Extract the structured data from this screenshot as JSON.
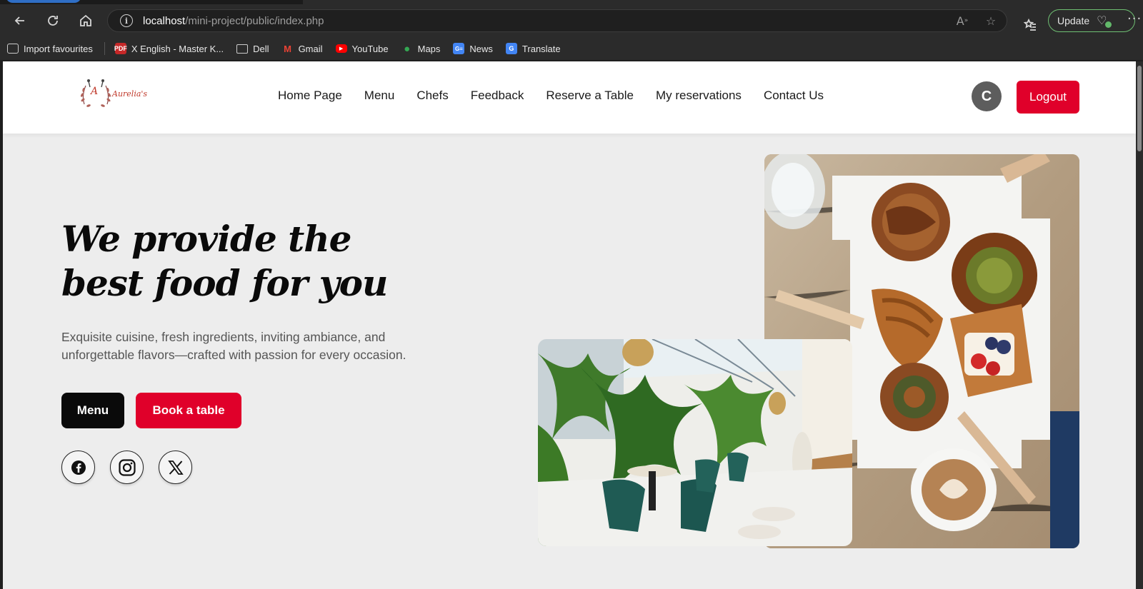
{
  "browser": {
    "url_host": "localhost",
    "url_path": "/mini-project/public/index.php",
    "update_label": "Update",
    "bookmarks": [
      {
        "label": "Import favourites",
        "icon": "import-icon"
      },
      {
        "label": "X English - Master K...",
        "icon": "pdf-icon"
      },
      {
        "label": "Dell",
        "icon": "folder-icon"
      },
      {
        "label": "Gmail",
        "icon": "gmail-icon"
      },
      {
        "label": "YouTube",
        "icon": "youtube-icon"
      },
      {
        "label": "Maps",
        "icon": "maps-icon"
      },
      {
        "label": "News",
        "icon": "news-icon"
      },
      {
        "label": "Translate",
        "icon": "translate-icon"
      }
    ]
  },
  "site": {
    "logo": {
      "letter": "A",
      "name": "Aurelia's"
    },
    "nav": [
      "Home Page",
      "Menu",
      "Chefs",
      "Feedback",
      "Reserve a Table",
      "My reservations",
      "Contact Us"
    ],
    "avatar_letter": "C",
    "logout_label": "Logout",
    "accent_color": "#e0002a"
  },
  "hero": {
    "title_line1": "We provide the",
    "title_line2": "best food for you",
    "subtitle": "Exquisite cuisine, fresh ingredients, inviting ambiance, and unforgettable flavors—crafted with passion for every occasion.",
    "menu_button": "Menu",
    "book_button": "Book a table",
    "socials": [
      "facebook-icon",
      "instagram-icon",
      "x-icon"
    ]
  }
}
